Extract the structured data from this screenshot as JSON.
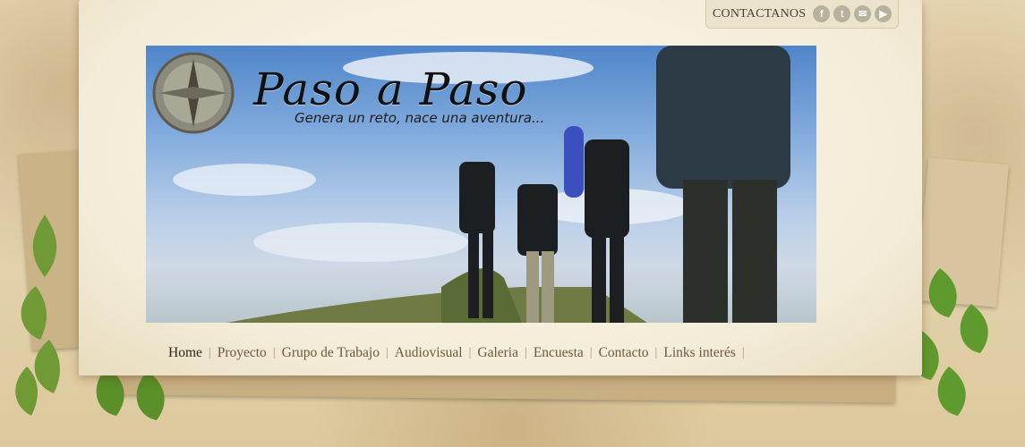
{
  "header": {
    "contact_label": "CONTACTANOS",
    "social_icons": [
      {
        "name": "facebook-icon",
        "glyph": "f"
      },
      {
        "name": "twitter-icon",
        "glyph": "t"
      },
      {
        "name": "email-icon",
        "glyph": "✉"
      },
      {
        "name": "youtube-icon",
        "glyph": "▶"
      }
    ]
  },
  "banner": {
    "title": "Paso a Paso",
    "tagline": "Genera un reto, nace una aventura..."
  },
  "nav": {
    "items": [
      "Home",
      "Proyecto",
      "Grupo de Trabajo",
      "Audiovisual",
      "Galeria",
      "Encuesta",
      "Contacto",
      "Links interés"
    ],
    "active": "Home"
  },
  "colors": {
    "paper": "#f7f1e2",
    "nav_text": "#6b5a3e",
    "nav_active": "#2e261a",
    "social_bg": "#b8b19b"
  }
}
